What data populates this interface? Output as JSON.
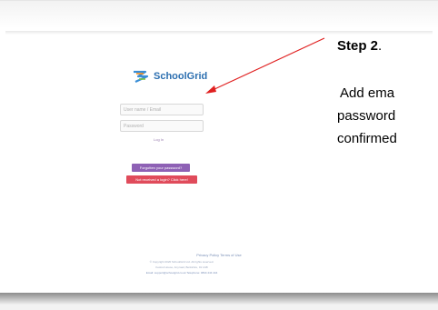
{
  "login": {
    "logo_text": "SchoolGrid",
    "email_placeholder": "User name / Email",
    "password_placeholder": "Password",
    "login_label": "Log In",
    "forgot_label": "Forgotten your password?",
    "no_account_label": "Not received a login? Click here!"
  },
  "footer": {
    "links": "Privacy Policy  Terms of Use",
    "line1": "© Copyright 2020 SchoolGrid Ltd. All rights reserved.",
    "line2": "Kestrel House, Anyroad, Berkshire, 01 1AB",
    "line3": "Email: support@schoolgrid.co.uk  Telephone: 0844 444 444"
  },
  "annotation": {
    "step_bold": "Step 2",
    "step_suffix": ".",
    "line1": "Add ema",
    "line2": "password",
    "line3": "confirmed"
  },
  "colors": {
    "arrow": "#e02020",
    "forgot_button": "#8e61b5",
    "no_account_button": "#e04b5b",
    "logo_text": "#2c6fb0"
  }
}
